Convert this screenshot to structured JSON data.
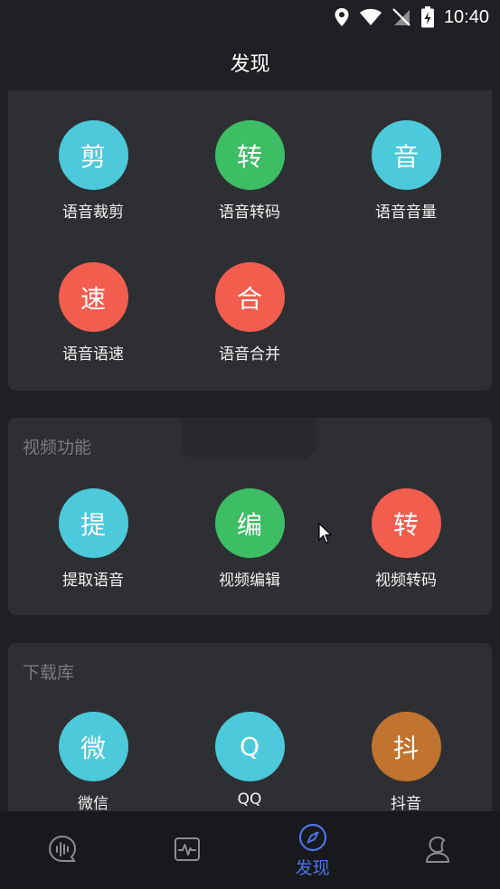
{
  "status": {
    "time": "10:40"
  },
  "header": {
    "title": "发现"
  },
  "audio_tools": [
    {
      "glyph": "剪",
      "label": "语音裁剪",
      "color": "#4cc9da"
    },
    {
      "glyph": "转",
      "label": "语音转码",
      "color": "#3dbd64"
    },
    {
      "glyph": "音",
      "label": "语音音量",
      "color": "#4cc9da"
    },
    {
      "glyph": "速",
      "label": "语音语速",
      "color": "#f25d4e"
    },
    {
      "glyph": "合",
      "label": "语音合并",
      "color": "#f25d4e"
    }
  ],
  "video": {
    "title": "视频功能",
    "tools": [
      {
        "glyph": "提",
        "label": "提取语音",
        "color": "#4cc9da"
      },
      {
        "glyph": "编",
        "label": "视频编辑",
        "color": "#3dbd64"
      },
      {
        "glyph": "转",
        "label": "视频转码",
        "color": "#f25d4e"
      }
    ]
  },
  "download": {
    "title": "下载库",
    "tools": [
      {
        "glyph": "微",
        "label": "微信",
        "color": "#4cc9da"
      },
      {
        "glyph": "Q",
        "label": "QQ",
        "color": "#4cc9da"
      },
      {
        "glyph": "抖",
        "label": "抖音",
        "color": "#c0742f"
      }
    ]
  },
  "tabs": [
    {
      "icon": "voice-bubble-icon",
      "label": ""
    },
    {
      "icon": "activity-icon",
      "label": ""
    },
    {
      "icon": "compass-icon",
      "label": "发现",
      "active": true
    },
    {
      "icon": "user-icon",
      "label": ""
    }
  ],
  "colors": {
    "accent": "#4b74e6",
    "card": "#2e2f33",
    "background": "#1f2023"
  }
}
